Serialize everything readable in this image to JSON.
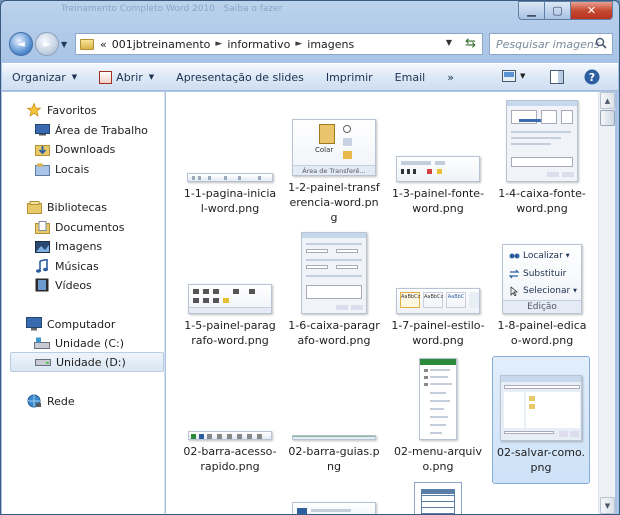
{
  "window": {
    "title_strip": "Treinamento Completo Word 2010 · Saiba o fazer"
  },
  "nav": {
    "back_glyph": "◄",
    "forward_glyph": "►",
    "address": {
      "overflow": "«",
      "crumbs": [
        "001jbtreinamento",
        "informativo",
        "imagens"
      ],
      "separator": "►"
    },
    "search_placeholder": "Pesquisar imagens"
  },
  "toolbar": {
    "organize": "Organizar",
    "open": "Abrir",
    "slideshow": "Apresentação de slides",
    "print": "Imprimir",
    "email": "Email",
    "more": "»"
  },
  "sidebar": {
    "favorites": {
      "header": "Favoritos",
      "items": [
        "Área de Trabalho",
        "Downloads",
        "Locais"
      ]
    },
    "libraries": {
      "header": "Bibliotecas",
      "items": [
        "Documentos",
        "Imagens",
        "Músicas",
        "Vídeos"
      ]
    },
    "computer": {
      "header": "Computador",
      "items": [
        "Unidade (C:)",
        "Unidade (D:)"
      ]
    },
    "network": {
      "header": "Rede"
    }
  },
  "files": [
    {
      "name": "1-1-pagina-inicial-word.png"
    },
    {
      "name": "1-2-painel-transferencia-word.png",
      "thumb_text": {
        "paste": "Colar",
        "group": "Área de Transferê..."
      }
    },
    {
      "name": "1-3-painel-fonte-word.png"
    },
    {
      "name": "1-4-caixa-fonte-word.png"
    },
    {
      "name": "1-5-painel-paragrafo-word.png"
    },
    {
      "name": "1-6-caixa-paragrafo-word.png"
    },
    {
      "name": "1-7-painel-estilo-word.png"
    },
    {
      "name": "1-8-painel-edicao-word.png",
      "thumb_text": {
        "find": "Localizar",
        "replace": "Substituir",
        "select": "Selecionar",
        "group": "Edição"
      }
    },
    {
      "name": "02-barra-acesso-rapido.png"
    },
    {
      "name": "02-barra-guias.png"
    },
    {
      "name": "02-menu-arquivo.png"
    },
    {
      "name": "02-salvar-como.png"
    }
  ],
  "colors": {
    "accent": "#2c5ea0",
    "selection": "#cde2f8",
    "close": "#c64a32"
  }
}
